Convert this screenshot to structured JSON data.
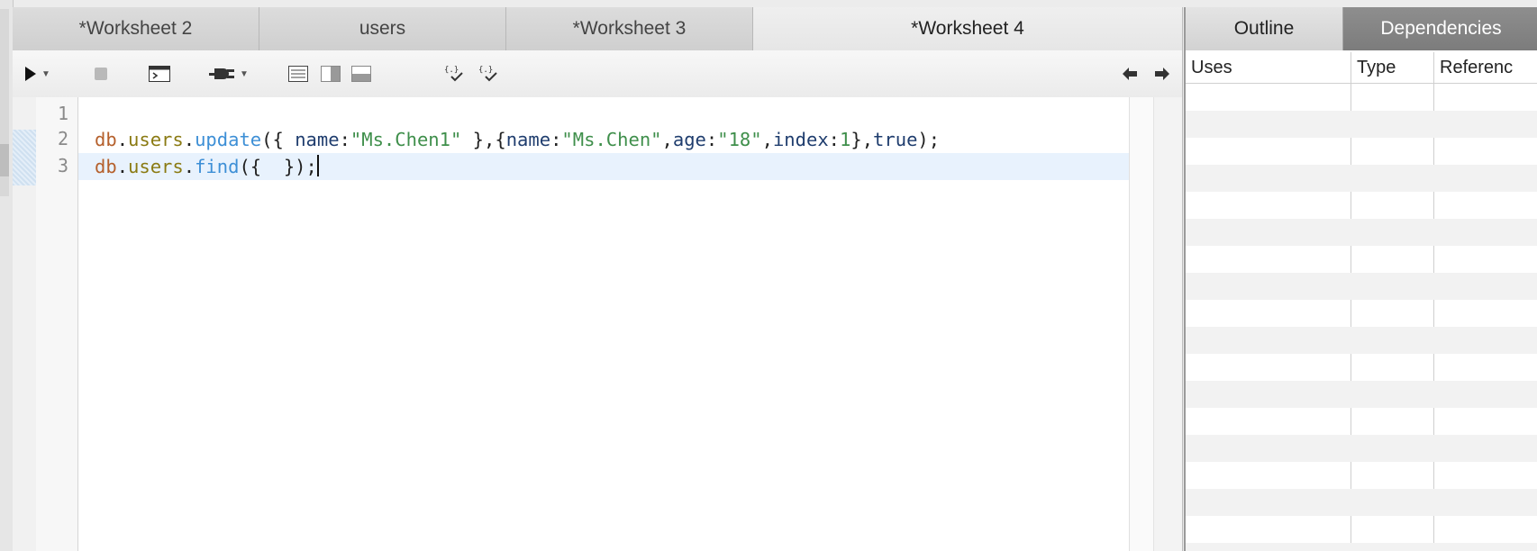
{
  "editor": {
    "tabs": [
      {
        "label": "*Worksheet 2",
        "width": 274
      },
      {
        "label": "users",
        "width": 274
      },
      {
        "label": "*Worksheet 3",
        "width": 274
      },
      {
        "label": "*Worksheet 4",
        "width": 476,
        "active": true
      }
    ],
    "toolbar": {
      "icons": [
        "run-icon",
        "stop-icon",
        "terminal-icon",
        "connection-plug-icon",
        "layout-list-icon",
        "layout-split-vertical-icon",
        "layout-split-horizontal-icon",
        "format-brackets-icon",
        "validate-brackets-icon",
        "back-arrow-icon",
        "forward-arrow-icon"
      ]
    },
    "line_numbers": [
      "1",
      "2",
      "3"
    ],
    "code": {
      "line2": {
        "db": "db",
        "dot1": ".",
        "coll": "users",
        "dot2": ".",
        "fn": "update",
        "p1": "({ ",
        "k1": "name",
        "c1": ":",
        "s1": "\"Ms.Chen1\"",
        "p2": " },{",
        "k2": "name",
        "c2": ":",
        "s2": "\"Ms.Chen\"",
        "p3": ",",
        "k3": "age",
        "c3": ":",
        "s3": "\"18\"",
        "p4": ",",
        "k4": "index",
        "c4": ":",
        "n4": "1",
        "p5": "},",
        "b": "true",
        "p6": ");"
      },
      "line3": {
        "db": "db",
        "dot1": ".",
        "coll": "users",
        "dot2": ".",
        "fn": "find",
        "p1": "({  });"
      }
    }
  },
  "right_panel": {
    "tabs": [
      {
        "label": "Outline"
      },
      {
        "label": "Dependencies",
        "active": true
      }
    ],
    "columns": [
      "Uses",
      "Type",
      "Referenc"
    ]
  },
  "colors": {
    "active_line": "#e8f2fd",
    "db_token": "#b5602c",
    "collection_token": "#8a7a12",
    "function_token": "#3d8fd6",
    "string_token": "#3f8f4b",
    "key_token": "#1f3d6e"
  }
}
